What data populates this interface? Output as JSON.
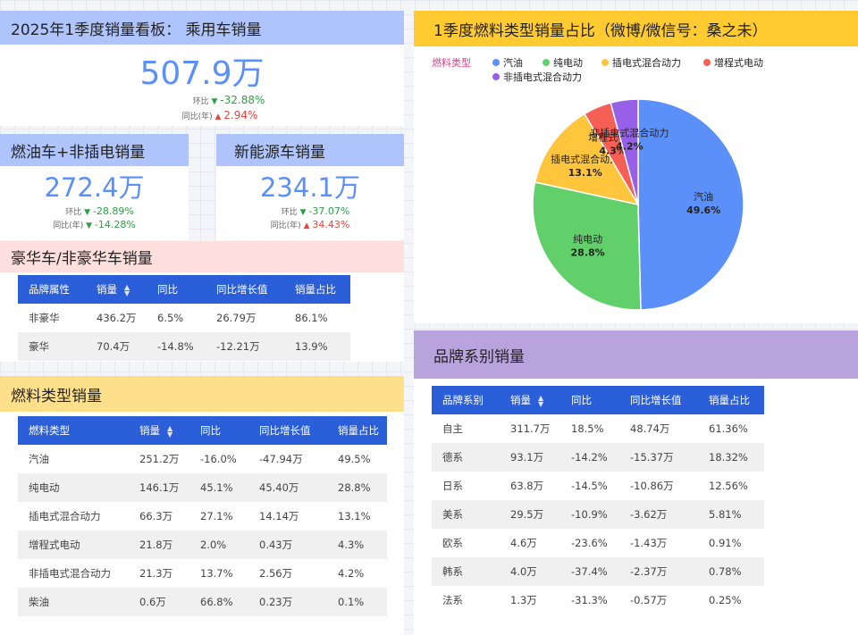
{
  "kpi_main": {
    "title": "2025年1季度销量看板：  乘用车销量",
    "value": "507.9万",
    "hb_label": "环比",
    "hb_value": "-32.88%",
    "tb_label": "同比(年)",
    "tb_value": "2.94%",
    "color": "#5b8ff9"
  },
  "kpi_fuel": {
    "title": "燃油车+非插电销量",
    "value": "272.4万",
    "hb_label": "环比",
    "hb_value": "-28.89%",
    "tb_label": "同比(年)",
    "tb_value": "-14.28%"
  },
  "kpi_nev": {
    "title": "新能源车销量",
    "value": "234.1万",
    "hb_label": "环比",
    "hb_value": "-37.07%",
    "tb_label": "同比(年)",
    "tb_value": "34.43%"
  },
  "luxury": {
    "title": "豪华车/非豪华车销量",
    "headers": [
      "品牌属性",
      "销量",
      "同比",
      "同比增长值",
      "销量占比"
    ],
    "rows": [
      [
        "非豪华",
        "436.2万",
        "6.5%",
        "26.79万",
        "86.1%"
      ],
      [
        "豪华",
        "70.4万",
        "-14.8%",
        "-12.21万",
        "13.9%"
      ]
    ]
  },
  "fuel_table": {
    "title": "燃料类型销量",
    "headers": [
      "燃料类型",
      "销量",
      "同比",
      "同比增长值",
      "销量占比"
    ],
    "rows": [
      [
        "汽油",
        "251.2万",
        "-16.0%",
        "-47.94万",
        "49.5%"
      ],
      [
        "纯电动",
        "146.1万",
        "45.1%",
        "45.40万",
        "28.8%"
      ],
      [
        "插电式混合动力",
        "66.3万",
        "27.1%",
        "14.14万",
        "13.1%"
      ],
      [
        "增程式电动",
        "21.8万",
        "2.0%",
        "0.43万",
        "4.3%"
      ],
      [
        "非插电式混合动力",
        "21.3万",
        "13.7%",
        "2.56万",
        "4.2%"
      ],
      [
        "柴油",
        "0.6万",
        "66.8%",
        "0.23万",
        "0.1%"
      ]
    ]
  },
  "brand_table": {
    "title": "品牌系别销量",
    "headers": [
      "品牌系别",
      "销量",
      "同比",
      "同比增长值",
      "销量占比"
    ],
    "rows": [
      [
        "自主",
        "311.7万",
        "18.5%",
        "48.74万",
        "61.36%"
      ],
      [
        "德系",
        "93.1万",
        "-14.2%",
        "-15.37万",
        "18.32%"
      ],
      [
        "日系",
        "63.8万",
        "-14.5%",
        "-10.86万",
        "12.56%"
      ],
      [
        "美系",
        "29.5万",
        "-10.9%",
        "-3.62万",
        "5.81%"
      ],
      [
        "欧系",
        "4.6万",
        "-23.6%",
        "-1.43万",
        "0.91%"
      ],
      [
        "韩系",
        "4.0万",
        "-37.4%",
        "-2.37万",
        "0.78%"
      ],
      [
        "法系",
        "1.3万",
        "-31.3%",
        "-0.57万",
        "0.25%"
      ]
    ]
  },
  "pie": {
    "title": "1季度燃料类型销量占比（微博/微信号：桑之未）",
    "legend_title": "燃料类型"
  },
  "chart_data": {
    "type": "pie",
    "title": "1季度燃料类型销量占比（微博/微信号：桑之未）",
    "legend_title": "燃料类型",
    "legend_position": "top-left",
    "categories": [
      "汽油",
      "纯电动",
      "插电式混合动力",
      "增程式电动",
      "非插电式混合动力"
    ],
    "values": [
      49.6,
      28.8,
      13.1,
      4.3,
      4.2
    ],
    "labels": [
      "49.6%",
      "28.8%",
      "13.1%",
      "4.3%",
      "4.2%"
    ],
    "colors": [
      "#5b8ff9",
      "#61d06b",
      "#ffc53d",
      "#f65f55",
      "#9660e8"
    ]
  },
  "colors": {
    "header_blue": "#aec4fb",
    "header_pink": "#fde0de",
    "header_yellow": "#ffe08a",
    "header_gold": "#ffcb30",
    "header_purple": "#b8a3dc",
    "table_header": "#2b5fd9",
    "up": "#e8453c",
    "down": "#2e9f45"
  }
}
